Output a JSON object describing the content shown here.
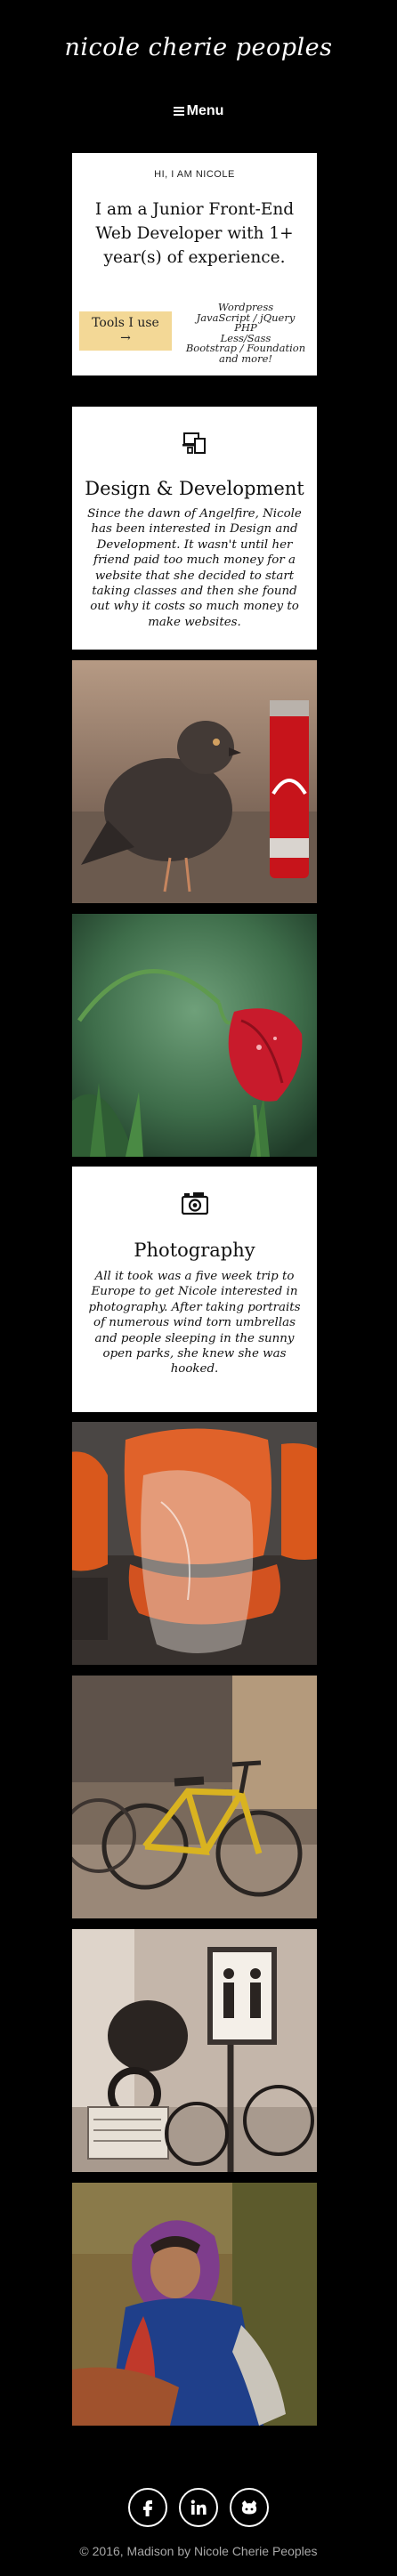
{
  "header": {
    "site_title": "nicole cherie peoples",
    "menu_label": "Menu"
  },
  "intro": {
    "kicker": "HI, I AM NICOLE",
    "headline": "I am a Junior Front-End Web Developer with 1+ year(s) of experience.",
    "tools_button": "Tools I use",
    "tools_arrow": "→",
    "tools": [
      "Wordpress",
      "JavaScript / jQuery",
      "PHP",
      "Less/Sass",
      "Bootstrap / Foundation",
      "and more!"
    ]
  },
  "design": {
    "icon": "devices-icon",
    "title": "Design & Development",
    "text": "Since the dawn of Angelfire, Nicole has been interested in Design and Development. It wasn't until her friend paid too much money for a website that she decided to start taking classes and then she found out why it costs so much money to make websites."
  },
  "photography": {
    "icon": "camera-icon",
    "title": "Photography",
    "text": "All it took was a five week trip to Europe to get Nicole interested in photography. After taking portraits of numerous wind torn umbrellas and people sleeping in the sunny open parks, she knew she was hooked."
  },
  "images": [
    "pigeon-and-soda-can-photo",
    "red-poppy-flower-photo",
    "orange-chairs-photo",
    "yellow-bicycle-photo",
    "parked-scooters-photo",
    "woman-in-headscarf-photo"
  ],
  "footer": {
    "social": [
      "facebook-icon",
      "linkedin-icon",
      "github-icon"
    ],
    "copyright": "© 2016, Madison by Nicole Cherie Peoples"
  }
}
